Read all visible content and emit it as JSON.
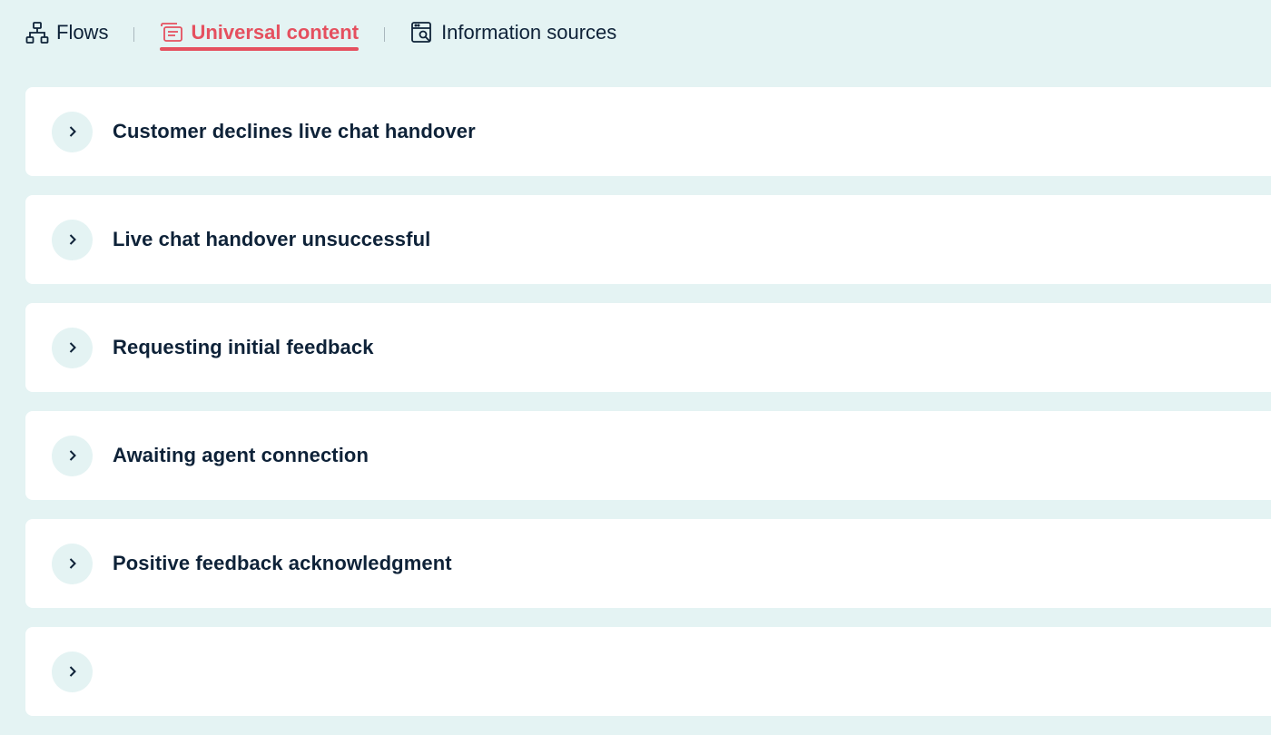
{
  "colors": {
    "background": "#e4f3f3",
    "accent": "#e5505f",
    "text": "#0e2238",
    "card": "#ffffff"
  },
  "tabs": [
    {
      "label": "Flows",
      "icon": "sitemap-icon",
      "active": false
    },
    {
      "label": "Universal content",
      "icon": "messages-icon",
      "active": true
    },
    {
      "label": "Information sources",
      "icon": "browser-search-icon",
      "active": false
    }
  ],
  "items": [
    {
      "title": "Customer declines live chat handover",
      "icon": "chevron-right-icon"
    },
    {
      "title": "Live chat handover unsuccessful",
      "icon": "chevron-right-icon"
    },
    {
      "title": "Requesting initial feedback",
      "icon": "chevron-right-icon"
    },
    {
      "title": "Awaiting agent connection",
      "icon": "chevron-right-icon"
    },
    {
      "title": "Positive feedback acknowledgment",
      "icon": "chevron-right-icon"
    },
    {
      "title": "",
      "icon": "chevron-right-icon"
    }
  ]
}
